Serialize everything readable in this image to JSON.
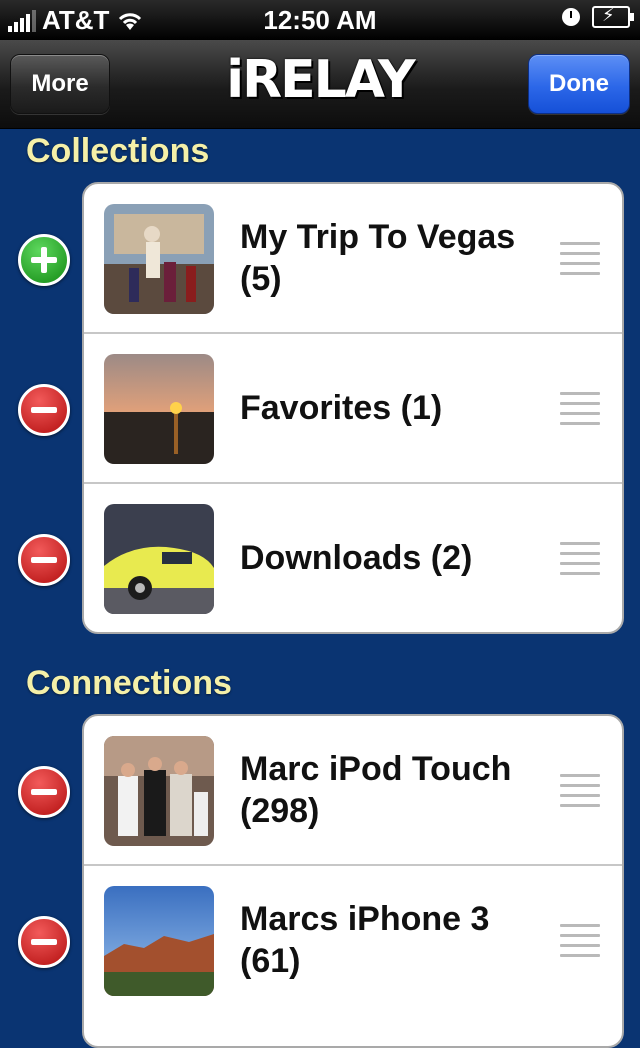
{
  "status": {
    "carrier": "AT&T",
    "time": "12:50 AM"
  },
  "nav": {
    "left_label": "More",
    "logo": "iRELAY",
    "right_label": "Done"
  },
  "sections": {
    "collections": {
      "title": "Collections",
      "items": [
        {
          "label": "My Trip To Vegas (5)",
          "control": "add",
          "thumb": "vegas-photo"
        },
        {
          "label": "Favorites (1)",
          "control": "delete",
          "thumb": "sunset-photo"
        },
        {
          "label": "Downloads (2)",
          "control": "delete",
          "thumb": "yellow-car-photo"
        }
      ]
    },
    "connections": {
      "title": "Connections",
      "items": [
        {
          "label": "Marc iPod Touch (298)",
          "control": "delete",
          "thumb": "family-photo"
        },
        {
          "label": "Marcs iPhone 3 (61)",
          "control": "delete",
          "thumb": "canyon-photo"
        }
      ]
    }
  },
  "colors": {
    "background": "#0a3472",
    "section_title": "#f5f0a8",
    "done_button": "#2c67e8"
  }
}
